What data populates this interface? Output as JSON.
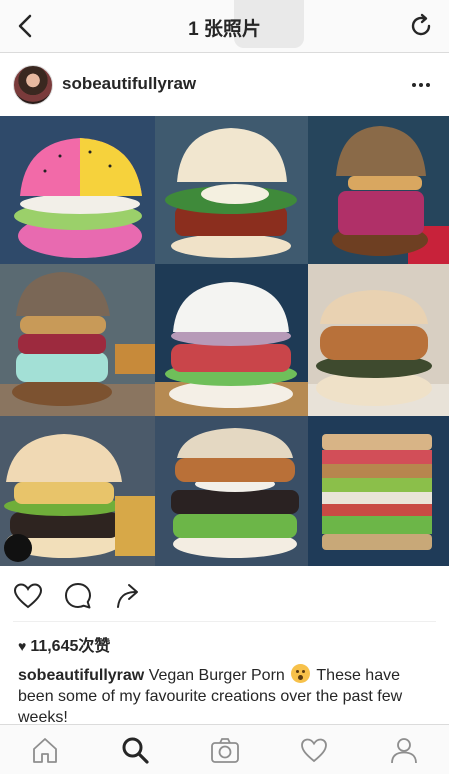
{
  "navbar": {
    "title": "1 张照片",
    "back_icon": "chevron-left-icon",
    "refresh_icon": "refresh-icon"
  },
  "post": {
    "username": "sobeautifullyraw",
    "more_icon": "ellipsis-icon",
    "image_description_alt": "",
    "likes": "11,645次赞",
    "caption": {
      "user": "sobeautifullyraw",
      "text_part1": " Vegan Burger Porn ",
      "emoji": "astonished-face-emoji",
      "text_part2": " These have been some of my favourite creations over the past few weeks!"
    }
  },
  "tabbar": {
    "items": [
      {
        "icon": "home-icon"
      },
      {
        "icon": "search-icon",
        "active": true
      },
      {
        "icon": "camera-icon"
      },
      {
        "icon": "heart-icon"
      },
      {
        "icon": "profile-icon"
      }
    ]
  },
  "colors": {
    "text": "#262626",
    "border": "#dbdbdb",
    "background": "#ffffff"
  }
}
